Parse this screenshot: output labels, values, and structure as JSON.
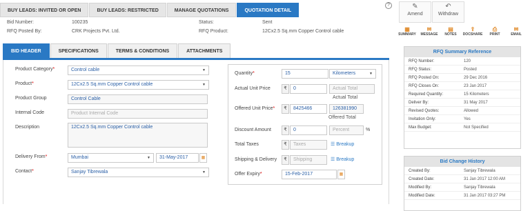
{
  "top_tabs": [
    "BUY LEADS: INVITED OR OPEN",
    "BUY LEADS: RESTRICTED",
    "MANAGE QUOTATIONS",
    "QUOTATION DETAIL"
  ],
  "help_glyph": "?",
  "info": {
    "bid_number_label": "Bid Number:",
    "bid_number": "100235",
    "status_label": "Status:",
    "status": "Sent",
    "rfq_posted_by_label": "RFQ Posted By:",
    "rfq_posted_by": "CRK Projects Pvt. Ltd.",
    "rfq_product_label": "RFQ Product:",
    "rfq_product": "12Cx2.5 Sq.mm Copper Control cable"
  },
  "sub_tabs": [
    "BID HEADER",
    "SPECIFICATIONS",
    "TERMS & CONDITIONS",
    "ATTACHMENTS"
  ],
  "form": {
    "product_category_label": "Product Category",
    "product_category": "Control cable",
    "product_label": "Product",
    "product": "12Cx2.5 Sq.mm Copper Control cable",
    "product_group_label": "Product Group",
    "product_group": "Control Cable",
    "internal_code_label": "Internal Code",
    "internal_code_placeholder": "Product Internal Code",
    "description_label": "Description",
    "description": "12Cx2.5 Sq.mm Copper Control cable",
    "delivery_from_label": "Delivery From",
    "delivery_from": "Mumbai",
    "delivery_date": "31-May-2017",
    "contact_label": "Contact",
    "contact": "Sanjay Tibrewala",
    "required_mark": "*",
    "quantity_label": "Quantity",
    "quantity": "15",
    "quantity_unit": "Kilometers",
    "actual_unit_price_label": "Actual Unit Price",
    "actual_unit_price": "0",
    "actual_total_placeholder": "Actual Total",
    "actual_total_caption": "Actual Total",
    "offered_unit_price_label": "Offered Unit Price",
    "offered_unit_price": "8425466",
    "offered_total": "126381990",
    "offered_total_caption": "Offered Total",
    "discount_amount_label": "Discount Amount",
    "discount_amount": "0",
    "percent_placeholder": "Percent",
    "percent_sign": "%",
    "total_taxes_label": "Total Taxes",
    "taxes_placeholder": "Taxes",
    "shipping_label": "Shipping & Delivery",
    "shipping_placeholder": "Shipping",
    "breakup_label": "Breakup",
    "offer_expiry_label": "Offer Expiry",
    "offer_expiry": "15-Feb-2017",
    "currency": "₹"
  },
  "tools": {
    "amend": "Amend",
    "withdraw": "Withdraw"
  },
  "actions": [
    "SUMMARY",
    "MESSAGE",
    "NOTES",
    "DOCSHARE",
    "PRINT",
    "EMAIL"
  ],
  "rfq_summary": {
    "title": "RFQ Summary Reference",
    "rows": [
      {
        "k": "RFQ Number:",
        "v": "120"
      },
      {
        "k": "RFQ Status:",
        "v": "Posted"
      },
      {
        "k": "RFQ Posted On:",
        "v": "29 Dec 2016"
      },
      {
        "k": "RFQ Closes On:",
        "v": "23 Jan 2017"
      },
      {
        "k": "Required Quantity:",
        "v": "15 Kilometers"
      },
      {
        "k": "Deliver By:",
        "v": "31 May 2017"
      },
      {
        "k": "Revised Quotes:",
        "v": "Allowed"
      },
      {
        "k": "Invitation Only:",
        "v": "Yes"
      },
      {
        "k": "Max Budget:",
        "v": "Not Specified"
      }
    ]
  },
  "bid_history": {
    "title": "Bid Change History",
    "rows": [
      {
        "k": "Created By:",
        "v": "Sanjay Tibrewala"
      },
      {
        "k": "Created Date:",
        "v": "31 Jan 2017 12:00 AM"
      },
      {
        "k": "Modified By:",
        "v": "Sanjay Tibrewala"
      },
      {
        "k": "Modified Date:",
        "v": "31 Jan 2017 03:27 PM"
      }
    ]
  },
  "colors": {
    "accent": "#2a79c4",
    "icon": "#e08a2a",
    "required": "#dd0000"
  }
}
